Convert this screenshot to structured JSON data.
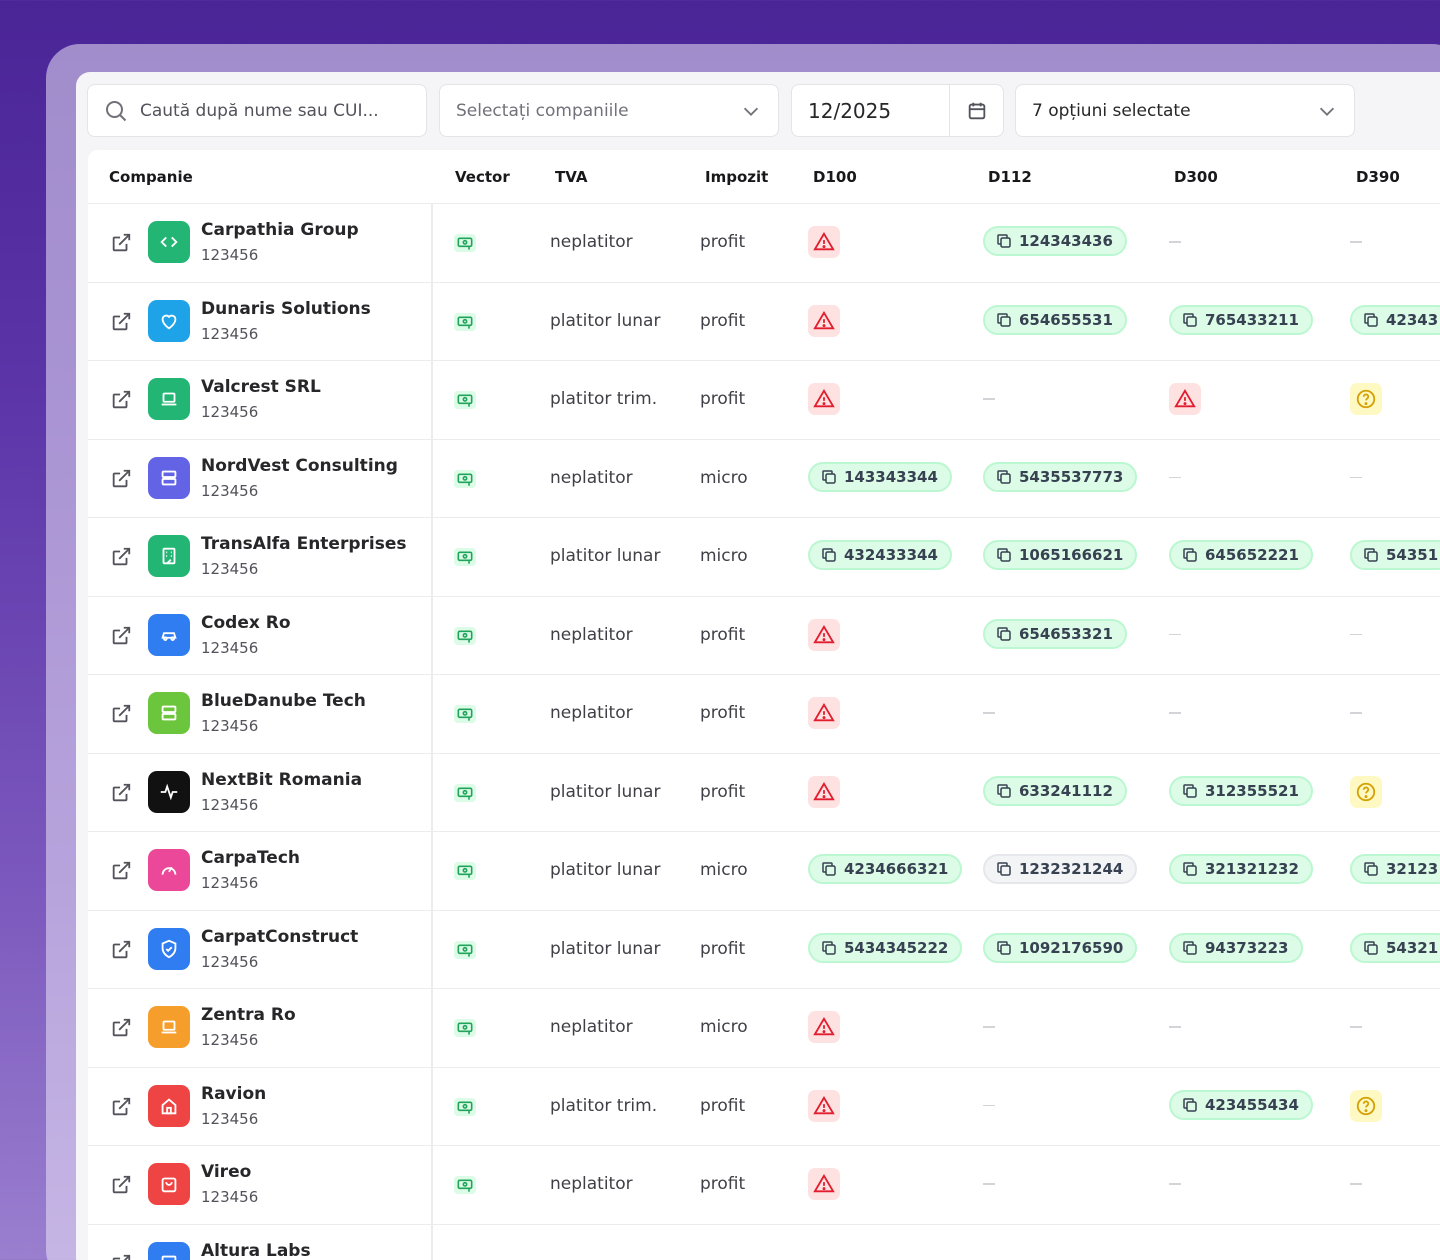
{
  "filters": {
    "search_placeholder": "Caută după nume sau CUI...",
    "company_select": "Selectați companiile",
    "month": "12/2025",
    "options_select": "7 opțiuni selectate"
  },
  "columns": [
    "Companie",
    "Vector",
    "TVA",
    "Impozit",
    "D100",
    "D112",
    "D300",
    "D390"
  ],
  "colors": {
    "pill_green": "#dcfce7",
    "warn_red": "#fee2e2",
    "question_yellow": "#fef9c3"
  },
  "rows": [
    {
      "name": "Carpathia Group",
      "cui": "123456",
      "logo_icon": "code-icon",
      "logo_color": "#22b573",
      "tva": "neplatitor",
      "impozit": "profit",
      "d100": {
        "type": "warn"
      },
      "d112": {
        "type": "pill",
        "value": "124343436"
      },
      "d300": {
        "type": "dash"
      },
      "d390": {
        "type": "dash"
      }
    },
    {
      "name": "Dunaris Solutions",
      "cui": "123456",
      "logo_icon": "heart-icon",
      "logo_color": "#1fa3e8",
      "tva": "platitor lunar",
      "impozit": "profit",
      "d100": {
        "type": "warn"
      },
      "d112": {
        "type": "pill",
        "value": "654655531"
      },
      "d300": {
        "type": "pill",
        "value": "765433211"
      },
      "d390": {
        "type": "pill",
        "value": "42343"
      }
    },
    {
      "name": "Valcrest SRL",
      "cui": "123456",
      "logo_icon": "laptop-icon",
      "logo_color": "#22b573",
      "tva": "platitor trim.",
      "impozit": "profit",
      "d100": {
        "type": "warn"
      },
      "d112": {
        "type": "dash"
      },
      "d300": {
        "type": "warn"
      },
      "d390": {
        "type": "question"
      }
    },
    {
      "name": "NordVest Consulting",
      "cui": "123456",
      "logo_icon": "server-icon",
      "logo_color": "#6363e6",
      "tva": "neplatitor",
      "impozit": "micro",
      "d100": {
        "type": "pill",
        "value": "143343344"
      },
      "d112": {
        "type": "pill",
        "value": "5435537773"
      },
      "d300": {
        "type": "dash"
      },
      "d390": {
        "type": "dash"
      }
    },
    {
      "name": "TransAlfa Enterprises",
      "cui": "123456",
      "logo_icon": "building-icon",
      "logo_color": "#22b573",
      "tva": "platitor lunar",
      "impozit": "micro",
      "d100": {
        "type": "pill",
        "value": "432433344"
      },
      "d112": {
        "type": "pill",
        "value": "1065166621"
      },
      "d300": {
        "type": "pill",
        "value": "645652221"
      },
      "d390": {
        "type": "pill",
        "value": "54351"
      }
    },
    {
      "name": "Codex Ro",
      "cui": "123456",
      "logo_icon": "car-icon",
      "logo_color": "#2f7df0",
      "tva": "neplatitor",
      "impozit": "profit",
      "d100": {
        "type": "warn"
      },
      "d112": {
        "type": "pill",
        "value": "654653321"
      },
      "d300": {
        "type": "dash"
      },
      "d390": {
        "type": "dash"
      }
    },
    {
      "name": "BlueDanube Tech",
      "cui": "123456",
      "logo_icon": "server-icon",
      "logo_color": "#6cc63d",
      "tva": "neplatitor",
      "impozit": "profit",
      "d100": {
        "type": "warn"
      },
      "d112": {
        "type": "dash"
      },
      "d300": {
        "type": "dash"
      },
      "d390": {
        "type": "dash"
      }
    },
    {
      "name": "NextBit Romania",
      "cui": "123456",
      "logo_icon": "activity-icon",
      "logo_color": "#111111",
      "tva": "platitor lunar",
      "impozit": "profit",
      "d100": {
        "type": "warn"
      },
      "d112": {
        "type": "pill",
        "value": "633241112"
      },
      "d300": {
        "type": "pill",
        "value": "312355521"
      },
      "d390": {
        "type": "question"
      }
    },
    {
      "name": "CarpaTech",
      "cui": "123456",
      "logo_icon": "gauge-icon",
      "logo_color": "#ec4899",
      "tva": "platitor lunar",
      "impozit": "micro",
      "d100": {
        "type": "pill",
        "value": "4234666321"
      },
      "d112": {
        "type": "pill-gray",
        "value": "1232321244"
      },
      "d300": {
        "type": "pill",
        "value": "321321232"
      },
      "d390": {
        "type": "pill",
        "value": "32123"
      }
    },
    {
      "name": "CarpatConstruct",
      "cui": "123456",
      "logo_icon": "shield-icon",
      "logo_color": "#2f7df0",
      "tva": "platitor lunar",
      "impozit": "profit",
      "d100": {
        "type": "pill",
        "value": "5434345222"
      },
      "d112": {
        "type": "pill",
        "value": "1092176590"
      },
      "d300": {
        "type": "pill",
        "value": "94373223"
      },
      "d390": {
        "type": "pill",
        "value": "54321"
      }
    },
    {
      "name": "Zentra Ro",
      "cui": "123456",
      "logo_icon": "laptop-icon",
      "logo_color": "#f59e2b",
      "tva": "neplatitor",
      "impozit": "micro",
      "d100": {
        "type": "warn"
      },
      "d112": {
        "type": "dash"
      },
      "d300": {
        "type": "dash"
      },
      "d390": {
        "type": "dash"
      }
    },
    {
      "name": "Ravion",
      "cui": "123456",
      "logo_icon": "home-icon",
      "logo_color": "#ef4444",
      "tva": "platitor trim.",
      "impozit": "profit",
      "d100": {
        "type": "warn"
      },
      "d112": {
        "type": "dash"
      },
      "d300": {
        "type": "pill",
        "value": "423455434"
      },
      "d390": {
        "type": "question"
      }
    },
    {
      "name": "Vireo",
      "cui": "123456",
      "logo_icon": "bag-icon",
      "logo_color": "#ef4444",
      "tva": "neplatitor",
      "impozit": "profit",
      "d100": {
        "type": "warn"
      },
      "d112": {
        "type": "dash"
      },
      "d300": {
        "type": "dash"
      },
      "d390": {
        "type": "dash"
      }
    },
    {
      "name": "Altura Labs",
      "cui": "",
      "logo_icon": "server-icon",
      "logo_color": "#2f7df0",
      "tva": "",
      "impozit": "",
      "d100": {
        "type": "none"
      },
      "d112": {
        "type": "none"
      },
      "d300": {
        "type": "none"
      },
      "d390": {
        "type": "none"
      }
    }
  ]
}
